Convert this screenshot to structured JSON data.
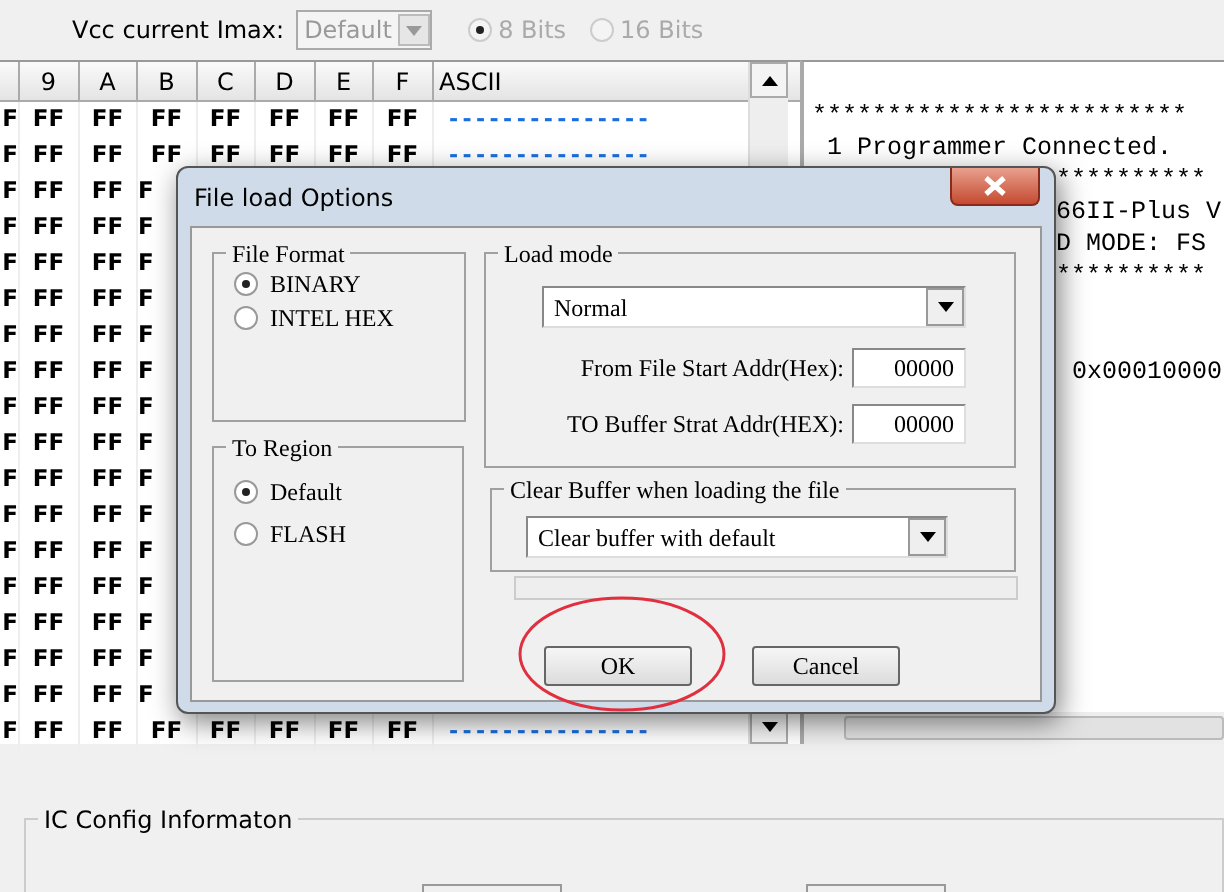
{
  "toolbar": {
    "vcc_label": "Vcc current Imax:",
    "imax": {
      "value": "Default",
      "disabled": true
    },
    "bits": [
      {
        "label": "8 Bits",
        "selected": true,
        "disabled": true
      },
      {
        "label": "16 Bits",
        "selected": false,
        "disabled": true
      }
    ]
  },
  "hex_grid": {
    "columns": [
      "",
      "9",
      "A",
      "B",
      "C",
      "D",
      "E",
      "F",
      "ASCII"
    ],
    "rows": [
      {
        "cells": [
          "F",
          "FF",
          "FF",
          "FF",
          "FF",
          "FF",
          "FF",
          "FF"
        ],
        "ascii": "---------------"
      },
      {
        "cells": [
          "F",
          "FF",
          "FF",
          "FF",
          "FF",
          "FF",
          "FF",
          "FF"
        ],
        "ascii": "---------------"
      },
      {
        "cells": [
          "F",
          "FF",
          "FF",
          "F"
        ]
      },
      {
        "cells": [
          "F",
          "FF",
          "FF",
          "F"
        ]
      },
      {
        "cells": [
          "F",
          "FF",
          "FF",
          "F"
        ]
      },
      {
        "cells": [
          "F",
          "FF",
          "FF",
          "F"
        ]
      },
      {
        "cells": [
          "F",
          "FF",
          "FF",
          "F"
        ]
      },
      {
        "cells": [
          "F",
          "FF",
          "FF",
          "F"
        ]
      },
      {
        "cells": [
          "F",
          "FF",
          "FF",
          "F"
        ]
      },
      {
        "cells": [
          "F",
          "FF",
          "FF",
          "F"
        ]
      },
      {
        "cells": [
          "F",
          "FF",
          "FF",
          "F"
        ]
      },
      {
        "cells": [
          "F",
          "FF",
          "FF",
          "F"
        ]
      },
      {
        "cells": [
          "F",
          "FF",
          "FF",
          "F"
        ]
      },
      {
        "cells": [
          "F",
          "FF",
          "FF",
          "F"
        ]
      },
      {
        "cells": [
          "F",
          "FF",
          "FF",
          "F"
        ]
      },
      {
        "cells": [
          "F",
          "FF",
          "FF",
          "F"
        ]
      },
      {
        "cells": [
          "F",
          "FF",
          "FF",
          "F"
        ]
      },
      {
        "cells": [
          "F",
          "FF",
          "FF",
          "FF",
          "FF",
          "FF",
          "FF",
          "FF"
        ],
        "ascii": "---------------"
      }
    ]
  },
  "log": {
    "lines": [
      {
        "text": "*************************",
        "cut": false
      },
      {
        "text": " 1 Programmer Connected.",
        "cut": false
      },
      {
        "text": "**********",
        "cut": true
      },
      {
        "text": "66II-Plus V",
        "cut": true
      },
      {
        "text": "D MODE: FS",
        "cut": true
      },
      {
        "text": "**********",
        "cut": true
      }
    ],
    "address": "0x00010000"
  },
  "dialog": {
    "title": "File load Options",
    "file_format": {
      "title": "File Format",
      "options": [
        {
          "label": "BINARY",
          "selected": true
        },
        {
          "label": "INTEL HEX",
          "selected": false
        }
      ]
    },
    "to_region": {
      "title": "To Region",
      "options": [
        {
          "label": "Default",
          "selected": true
        },
        {
          "label": "FLASH",
          "selected": false
        }
      ]
    },
    "load_mode": {
      "title": "Load mode",
      "mode": "Normal",
      "fields": [
        {
          "label": "From File Start Addr(Hex):",
          "value": "00000"
        },
        {
          "label": "TO Buffer Strat Addr(HEX):",
          "value": "00000"
        }
      ]
    },
    "clear_buffer": {
      "title": "Clear Buffer when loading the file",
      "value": "Clear buffer with default"
    },
    "progress": {
      "level": 0
    },
    "buttons": [
      {
        "label": "OK",
        "circled": true
      },
      {
        "label": "Cancel",
        "circled": false
      }
    ]
  },
  "ic_config": {
    "title": "IC Config Informaton"
  }
}
